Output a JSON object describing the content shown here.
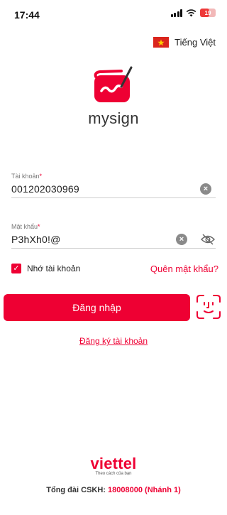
{
  "status_bar": {
    "time": "17:44",
    "battery": "19"
  },
  "language": {
    "label": "Tiếng Việt",
    "flag_icon": "vietnam-flag-icon"
  },
  "logo": {
    "text": "mysign",
    "color": "#ee0033"
  },
  "form": {
    "account": {
      "label": "Tài khoản",
      "required_mark": "*",
      "value": "001202030969"
    },
    "password": {
      "label": "Mật khẩu",
      "required_mark": "*",
      "value": "P3hXh0!@"
    },
    "remember": {
      "label": "Nhớ tài khoản",
      "checked": true
    },
    "forgot_label": "Quên mật khẩu?",
    "login_label": "Đăng nhập",
    "register_label": "Đăng ký tài khoản"
  },
  "footer": {
    "brand": "viettel",
    "slogan": "Theo cách của bạn",
    "hotline_label": "Tổng đài CSKH:",
    "hotline_number": "18008000 (Nhánh 1)"
  },
  "colors": {
    "accent": "#ee0033"
  }
}
